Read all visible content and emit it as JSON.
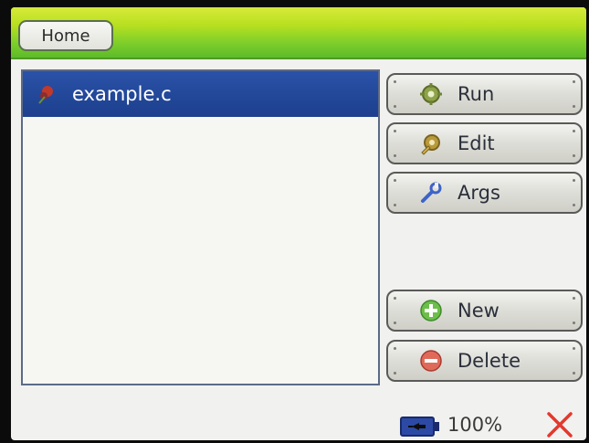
{
  "header": {
    "home_label": "Home"
  },
  "file_list": {
    "items": [
      {
        "name": "example.c",
        "icon": "c-source-file-icon"
      }
    ]
  },
  "actions": {
    "run": "Run",
    "edit": "Edit",
    "args": "Args",
    "new": "New",
    "delete": "Delete"
  },
  "status": {
    "battery_percent": "100%"
  },
  "colors": {
    "header_green": "#8fd42b",
    "selection_blue": "#1d3f8d",
    "close_red": "#e2392e"
  }
}
